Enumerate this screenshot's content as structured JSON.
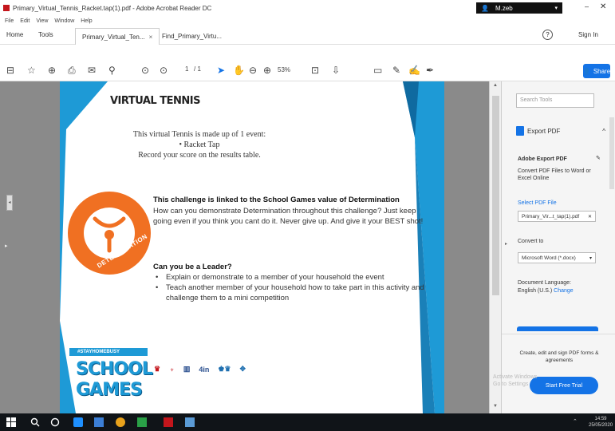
{
  "window": {
    "title": "Primary_Virtual_Tennis_Racket.tap(1).pdf - Adobe Acrobat Reader DC",
    "user_name": "M.zeb",
    "minimize_icon": "minimize-icon",
    "close_icon": "close-icon"
  },
  "menu": [
    "File",
    "Edit",
    "View",
    "Window",
    "Help"
  ],
  "tabs": {
    "home": "Home",
    "tools": "Tools",
    "doc1": "Primary_Virtual_Ten...",
    "doc2": "Find_Primary_Virtu...",
    "help": "?",
    "signin": "Sign In"
  },
  "toolbar": {
    "page_current": "1",
    "page_total": "/ 1",
    "zoom": "53%",
    "share": "Share"
  },
  "page": {
    "title": "VIRTUAL TENNIS",
    "intro_line1": "This virtual Tennis is made up of 1 event:",
    "intro_bullet": "•   Racket Tap",
    "intro_line3": "Record your score on the results table.",
    "badge_label": "DETERMINATION",
    "challenge_heading": "This challenge is linked to the School Games value of Determination",
    "challenge_body": "How can you demonstrate Determination throughout this challenge? Just keep going even if you think you cant do it. Never give up. And give it your BEST shot!",
    "leader_heading": "Can you be a Leader?",
    "leader_items": [
      "Explain or demonstrate to a member of your household the event",
      "Teach another member of your household how to take part in this activity and challenge them to a mini competition"
    ],
    "sg_bar": "#STAYHOMEBUSY",
    "sg_line1": "SCHOOL",
    "sg_line2": "GAMES",
    "partners": [
      "♛",
      "♆",
      "▥",
      "4in",
      "♚♛",
      "✥"
    ]
  },
  "right_panel": {
    "search_placeholder": "Search Tools",
    "export_title": "Export PDF",
    "adobe_export": "Adobe Export PDF",
    "convert_text": "Convert PDF Files to Word or Excel Online",
    "select_file": "Select PDF File",
    "file_value": "Primary_Vir...t_tap(1).pdf",
    "convert_to": "Convert to",
    "format_value": "Microsoft Word (*.docx)",
    "doc_language": "Document Language:",
    "language_value": "English (U.S.)",
    "change": "Change",
    "promo": "Create, edit and sign PDF forms & agreements",
    "trial": "Start Free Trial"
  },
  "ghost_text": "Activate Windows\nGo to Settings",
  "taskbar": {
    "time": "14:59",
    "date": "25/05/2020"
  },
  "colors": {
    "accent": "#1473e6",
    "page_blue": "#1e9ad6",
    "badge_orange": "#f07022",
    "acrobat_red": "#c4161c"
  }
}
